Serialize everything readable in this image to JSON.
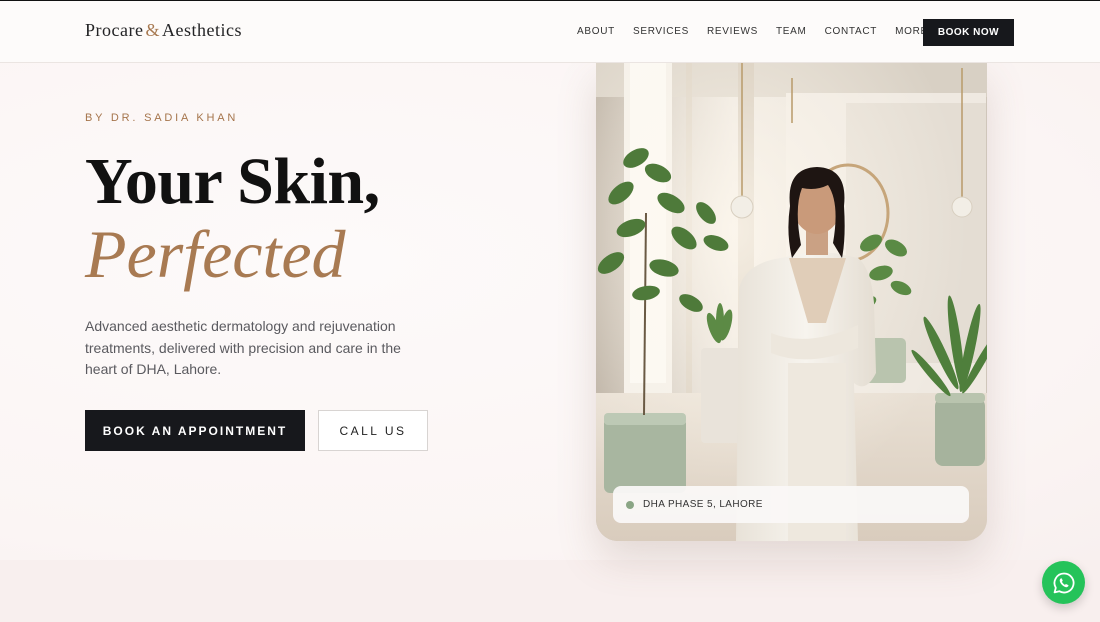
{
  "brand": {
    "name_part1": "Procare",
    "ampersand": "&",
    "name_part2": "Aesthetics",
    "accent_color": "#a87a52"
  },
  "nav": {
    "items": [
      "ABOUT",
      "SERVICES",
      "REVIEWS",
      "TEAM",
      "CONTACT"
    ],
    "more_label": "MORE",
    "more_icon": "chevron-down-icon",
    "cta_label": "BOOK NOW"
  },
  "hero": {
    "eyebrow": "BY DR. SADIA KHAN",
    "headline_line1": "Your Skin,",
    "headline_line2": "Perfected",
    "description": "Advanced aesthetic dermatology and rejuvenation treatments, delivered with precision and care in the heart of DHA, Lahore.",
    "primary_button": "BOOK AN APPOINTMENT",
    "secondary_button": "CALL US",
    "location_badge": "DHA PHASE 5, LAHORE",
    "status_dot_color": "#8aa585"
  },
  "floating": {
    "whatsapp_icon": "whatsapp-icon",
    "whatsapp_color": "#25c35a"
  },
  "colors": {
    "dark": "#17181c",
    "background": "#fcf8f7"
  }
}
